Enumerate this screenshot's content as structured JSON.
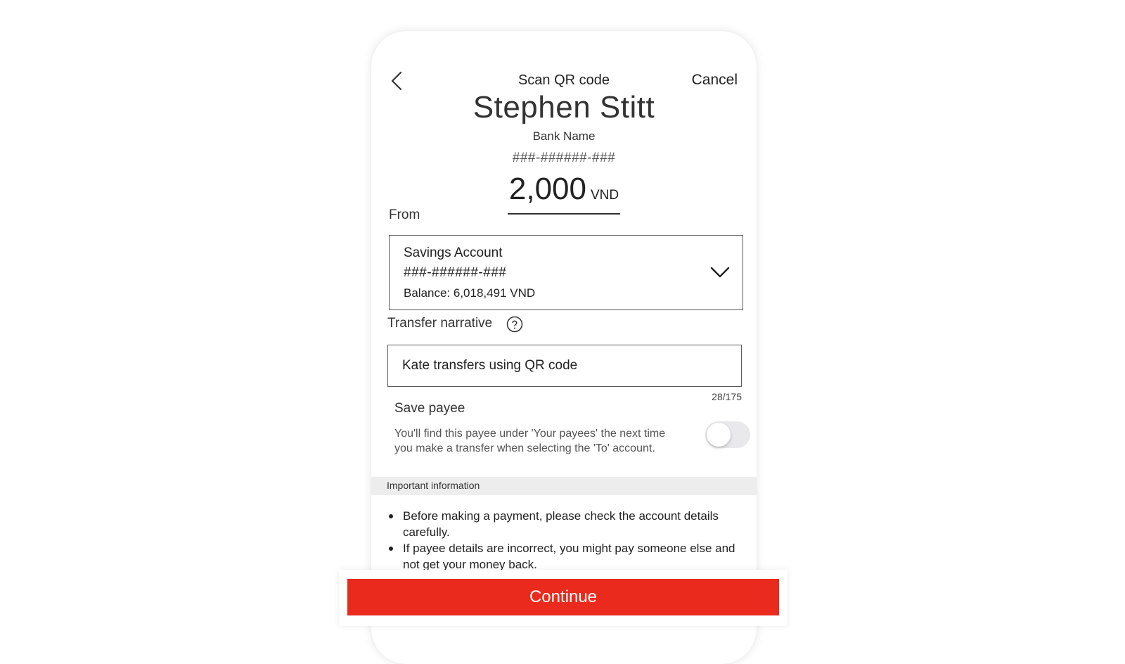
{
  "header": {
    "title": "Scan QR code",
    "cancel_label": "Cancel"
  },
  "payee": {
    "name": "Stephen Stitt",
    "bank_name": "Bank Name",
    "account_number": "###-######-###"
  },
  "amount": {
    "value": "2,000",
    "currency": "VND"
  },
  "from": {
    "label": "From",
    "account_name": "Savings Account",
    "account_number": "###-######-###",
    "balance": "Balance: 6,018,491 VND"
  },
  "narrative": {
    "label": "Transfer narrative",
    "value": "Kate transfers using QR code",
    "counter": "28/175"
  },
  "save_payee": {
    "title": "Save payee",
    "description": "You'll find this payee under 'Your payees' the next time you make a transfer when selecting the 'To' account.",
    "enabled": false
  },
  "important": {
    "title": "Important information",
    "items": [
      "Before making a payment, please check the account details carefully.",
      "If payee details are incorrect, you might pay someone else and not get your money back."
    ]
  },
  "continue_label": "Continue",
  "colors": {
    "primary": "#ea2a1c",
    "info_bar": "#ededed",
    "toggle_off": "#e9e9eb"
  },
  "icons": {
    "back": "chevron-left-icon",
    "dropdown": "chevron-down-icon",
    "help": "help-circle-icon"
  }
}
